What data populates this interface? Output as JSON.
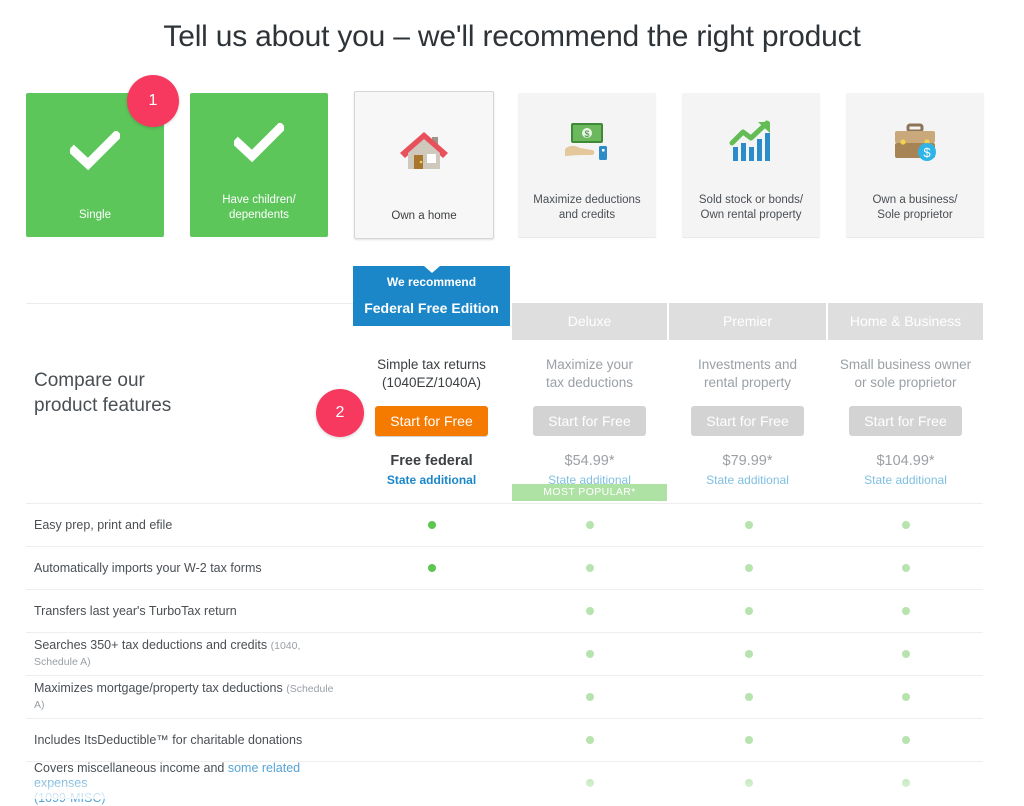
{
  "headline": "Tell us about you – we'll recommend the right product",
  "badges": [
    {
      "label": "1"
    },
    {
      "label": "2"
    }
  ],
  "situation_cards": [
    {
      "label_line1": "Single",
      "label_line2": "",
      "state": "selected",
      "icon": "check-icon"
    },
    {
      "label_line1": "Have children/",
      "label_line2": "dependents",
      "state": "selected",
      "icon": "check-icon"
    },
    {
      "label_line1": "Own a home",
      "label_line2": "",
      "state": "highlight",
      "icon": "house-icon"
    },
    {
      "label_line1": "Maximize deductions",
      "label_line2": "and credits",
      "state": "plain",
      "icon": "money-hand-icon"
    },
    {
      "label_line1": "Sold stock or bonds/",
      "label_line2": "Own rental property",
      "state": "plain",
      "icon": "chart-growth-icon"
    },
    {
      "label_line1": "Own a business/",
      "label_line2": "Sole proprietor",
      "state": "plain",
      "icon": "briefcase-dollar-icon"
    }
  ],
  "compare": {
    "title_line1": "Compare our",
    "title_line2": "product features",
    "most_popular_badge": "MOST POPULAR*"
  },
  "products": [
    {
      "recommend_label": "We recommend",
      "name": "Federal Free Edition",
      "desc_line1": "Simple tax returns",
      "desc_line2": "(1040EZ/1040A)",
      "cta": "Start for Free",
      "price": "Free federal",
      "state_note": "State additional"
    },
    {
      "name": "Deluxe",
      "desc_line1": "Maximize your",
      "desc_line2": "tax deductions",
      "cta": "Start for Free",
      "price": "$54.99*",
      "state_note": "State additional"
    },
    {
      "name": "Premier",
      "desc_line1": "Investments and",
      "desc_line2": "rental property",
      "cta": "Start for Free",
      "price": "$79.99*",
      "state_note": "State additional"
    },
    {
      "name": "Home & Business",
      "desc_line1": "Small business owner",
      "desc_line2": "or sole proprietor",
      "cta": "Start for Free",
      "price": "$104.99*",
      "state_note": "State additional"
    }
  ],
  "features": [
    {
      "text": "Easy prep, print and efile",
      "note": "",
      "link": "",
      "free": true,
      "deluxe": true,
      "premier": true,
      "home_business": true
    },
    {
      "text": "Automatically imports your W-2 tax forms",
      "note": "",
      "link": "",
      "free": true,
      "deluxe": true,
      "premier": true,
      "home_business": true
    },
    {
      "text": "Transfers last year's TurboTax return",
      "note": "",
      "link": "",
      "free": false,
      "deluxe": true,
      "premier": true,
      "home_business": true
    },
    {
      "text": "Searches 350+ tax deductions and credits",
      "note": "(1040, Schedule A)",
      "link": "",
      "free": false,
      "deluxe": true,
      "premier": true,
      "home_business": true
    },
    {
      "text": "Maximizes mortgage/property tax deductions",
      "note": "(Schedule A)",
      "link": "",
      "free": false,
      "deluxe": true,
      "premier": true,
      "home_business": true
    },
    {
      "text": "Includes ItsDeductible™ for charitable donations",
      "note": "",
      "link": "",
      "free": false,
      "deluxe": true,
      "premier": true,
      "home_business": true
    },
    {
      "text": "Covers miscellaneous income and ",
      "link": "some related expenses",
      "note": "(1099-MISC)",
      "free": false,
      "deluxe": true,
      "premier": true,
      "home_business": true
    }
  ],
  "colors": {
    "selected_card_green": "#5cc65a",
    "badge_pink": "#f7385f",
    "recommend_blue": "#1b87c9",
    "cta_orange": "#f57a00",
    "free_column_bg": "#e7f2f9",
    "header_gray": "#dedede",
    "dot_green": "#5cc74e",
    "dot_pale_green": "#b7e3ae",
    "most_popular_green": "#aee2a4"
  }
}
